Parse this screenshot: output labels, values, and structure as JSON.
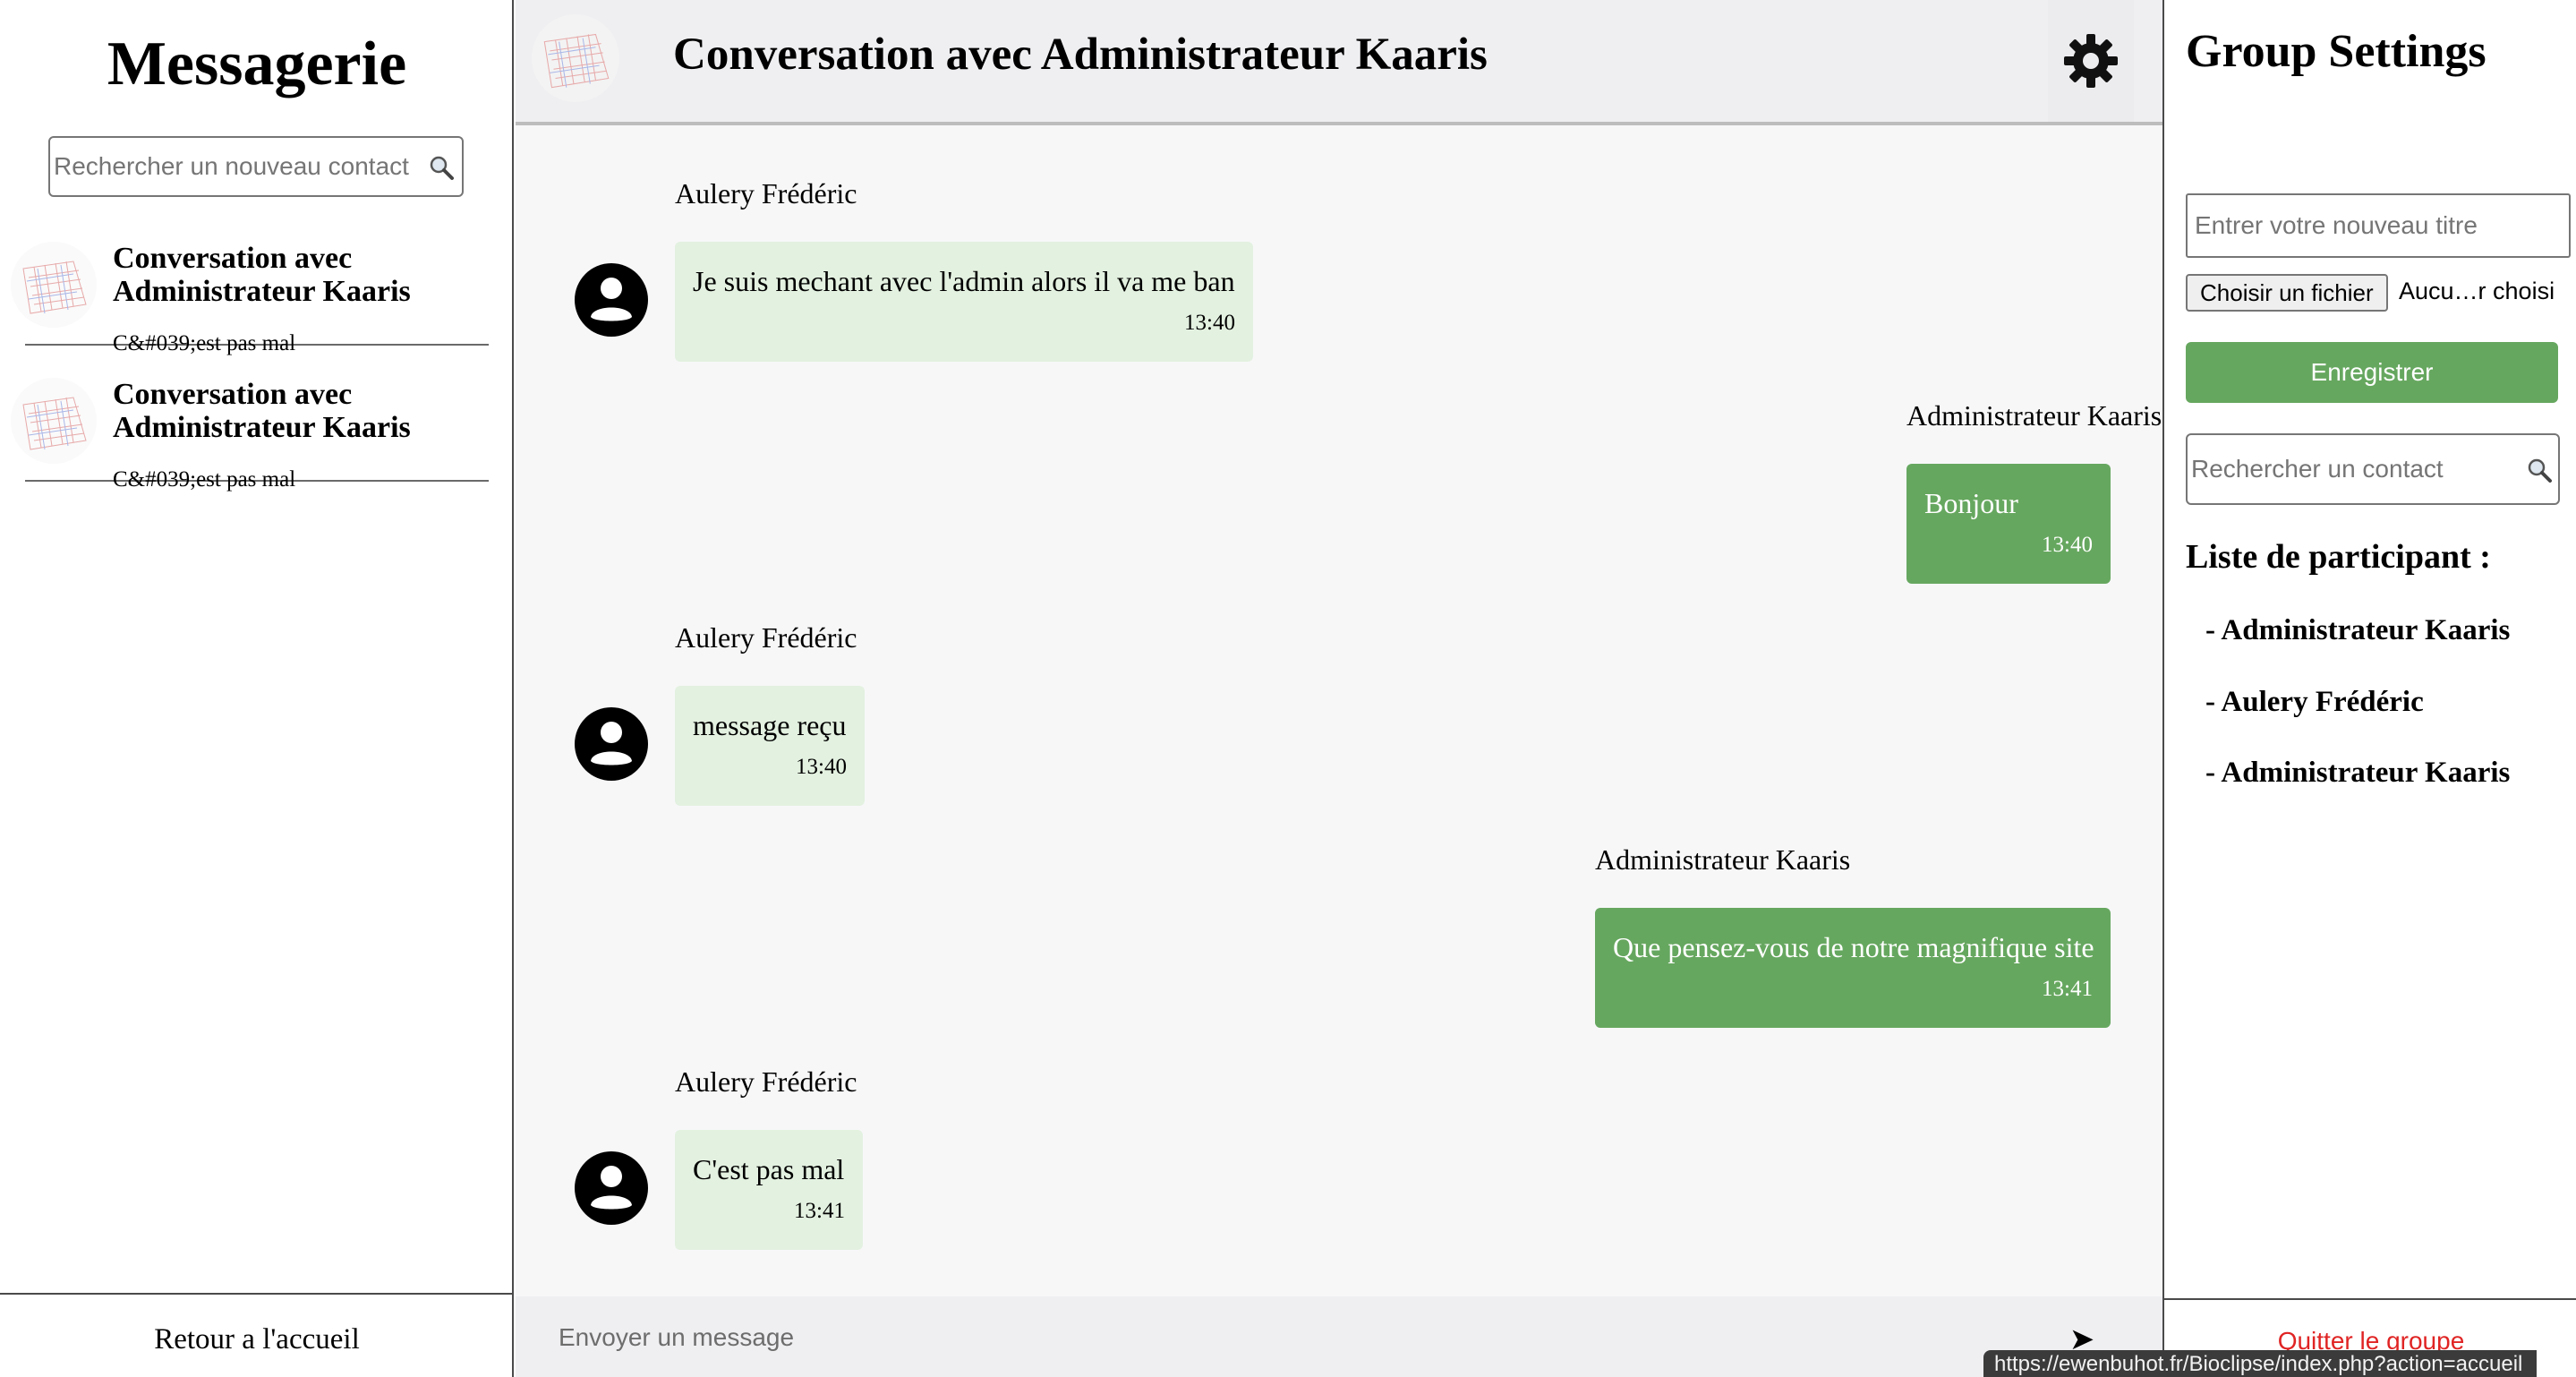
{
  "sidebar": {
    "title": "Messagerie",
    "search_placeholder": "Rechercher un nouveau contact",
    "conversations": [
      {
        "title": "Conversation avec Administrateur Kaaris",
        "preview": "C&#039;est pas mal"
      },
      {
        "title": "Conversation avec Administrateur Kaaris",
        "preview": "C&#039;est pas mal"
      }
    ],
    "home_link": "Retour a l'accueil"
  },
  "chat": {
    "title": "Conversation avec Administrateur Kaaris",
    "messages": [
      {
        "sender": "Aulery Frédéric",
        "text": "Je suis mechant avec l'admin alors il va me ban",
        "time": "13:40",
        "outgoing": false
      },
      {
        "sender": "Administrateur Kaaris",
        "text": "Bonjour",
        "time": "13:40",
        "outgoing": true
      },
      {
        "sender": "Aulery Frédéric",
        "text": "message reçu",
        "time": "13:40",
        "outgoing": false
      },
      {
        "sender": "Administrateur Kaaris",
        "text": "Que pensez-vous de notre magnifique site",
        "time": "13:41",
        "outgoing": true
      },
      {
        "sender": "Aulery Frédéric",
        "text": "C'est pas mal",
        "time": "13:41",
        "outgoing": false
      }
    ],
    "input_placeholder": "Envoyer un message",
    "send_icon": "➤"
  },
  "settings": {
    "title": "Group Settings",
    "title_input_placeholder": "Entrer votre nouveau titre",
    "file_button": "Choisir un fichier",
    "file_status": "Aucu…r choisi",
    "save_button": "Enregistrer",
    "contact_search_placeholder": "Rechercher un contact",
    "participants_heading": "Liste de participant :",
    "participants": [
      "- Administrateur Kaaris",
      "- Aulery Frédéric",
      "- Administrateur Kaaris"
    ],
    "leave_button": "Quitter le groupe"
  },
  "status_bar": {
    "url": "https://ewenbuhot.fr/Bioclipse/index.php?action=accueil"
  },
  "icons": {
    "search": "search-icon",
    "settings": "gear-icon",
    "user": "user-avatar-icon",
    "send": "send-icon"
  },
  "colors": {
    "accent_green": "#66a75f",
    "incoming_bubble": "#e3f1e0",
    "leave_red": "#e02424",
    "header_bg": "#efeff2",
    "chat_bg": "#f7f7f8"
  }
}
